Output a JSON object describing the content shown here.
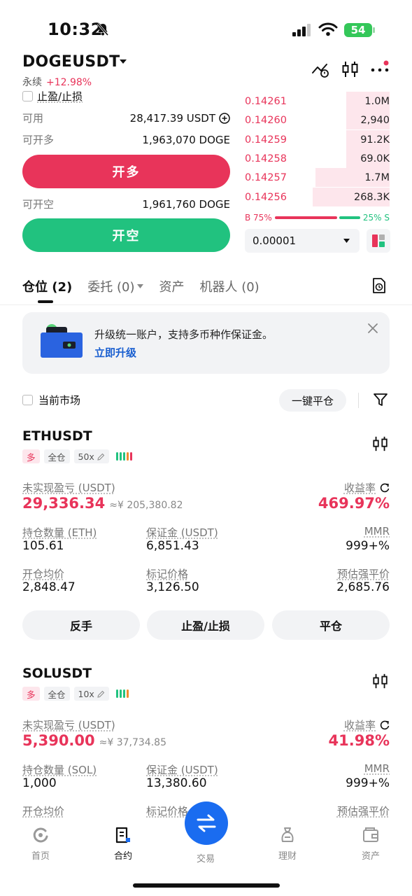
{
  "status_bar": {
    "time": "10:32",
    "battery": "54"
  },
  "header": {
    "symbol": "DOGEUSDT",
    "contract_type": "永续",
    "change": "+12.98%",
    "tpsl_label": "止盈/止损"
  },
  "trade_panel": {
    "available_label": "可用",
    "available_value": "28,417.39 USDT",
    "open_long_label": "可开多",
    "open_long_value": "1,963,070 DOGE",
    "long_button": "开多",
    "open_short_label": "可开空",
    "open_short_value": "1,961,760 DOGE",
    "short_button": "开空"
  },
  "order_book": {
    "asks": [
      {
        "price": "0.14261",
        "size": "1.0M",
        "depth": 0.3
      },
      {
        "price": "0.14260",
        "size": "2,940",
        "depth": 0.3
      },
      {
        "price": "0.14259",
        "size": "91.2K",
        "depth": 0.3
      },
      {
        "price": "0.14258",
        "size": "69.0K",
        "depth": 0.3
      },
      {
        "price": "0.14257",
        "size": "1.7M",
        "depth": 0.51
      },
      {
        "price": "0.14256",
        "size": "268.3K",
        "depth": 0.53
      }
    ],
    "buy_ratio": "B 75%",
    "sell_ratio": "25% S",
    "buy_fraction": 0.75,
    "precision": "0.00001"
  },
  "tabs": [
    {
      "label": "仓位 (2)"
    },
    {
      "label": "委托 (0)"
    },
    {
      "label": "资产"
    },
    {
      "label": "机器人 (0)"
    }
  ],
  "banner": {
    "text": "升级统一账户，支持多币种作保证金。",
    "link": "立即升级"
  },
  "filter": {
    "current_market": "当前市场",
    "close_all": "一键平仓"
  },
  "positions": [
    {
      "symbol": "ETHUSDT",
      "side": "多",
      "margin_mode": "全仓",
      "leverage": "50x",
      "pnl_label": "未实现盈亏 (USDT)",
      "pnl": "29,336.34",
      "pnl_cny": "≈¥ 205,380.82",
      "roe_label": "收益率",
      "roe": "469.97%",
      "qty_label": "持仓数量 (ETH)",
      "qty": "105.61",
      "margin_label": "保证金 (USDT)",
      "margin": "6,851.43",
      "mmr_label": "MMR",
      "mmr": "999+%",
      "entry_label": "开仓均价",
      "entry": "2,848.47",
      "mark_label": "标记价格",
      "mark": "3,126.50",
      "liq_label": "预估强平价",
      "liq": "2,685.76",
      "btn_reverse": "反手",
      "btn_tpsl": "止盈/止损",
      "btn_close": "平仓"
    },
    {
      "symbol": "SOLUSDT",
      "side": "多",
      "margin_mode": "全仓",
      "leverage": "10x",
      "pnl_label": "未实现盈亏 (USDT)",
      "pnl": "5,390.00",
      "pnl_cny": "≈¥ 37,734.85",
      "roe_label": "收益率",
      "roe": "41.98%",
      "qty_label": "持仓数量 (SOL)",
      "qty": "1,000",
      "margin_label": "保证金 (USDT)",
      "margin": "13,380.60",
      "mmr_label": "MMR",
      "mmr": "999+%",
      "entry_label": "开仓均价",
      "mark_label": "标记价格",
      "liq_label": "预估强平价"
    }
  ],
  "bottom_nav": [
    {
      "label": "首页"
    },
    {
      "label": "合约"
    },
    {
      "label": "交易"
    },
    {
      "label": "理财"
    },
    {
      "label": "资产"
    }
  ],
  "colors": {
    "long": "#e8345a",
    "short": "#21c27f",
    "accent_blue": "#1a6cf0",
    "liq_orange": "#f08c2e"
  }
}
